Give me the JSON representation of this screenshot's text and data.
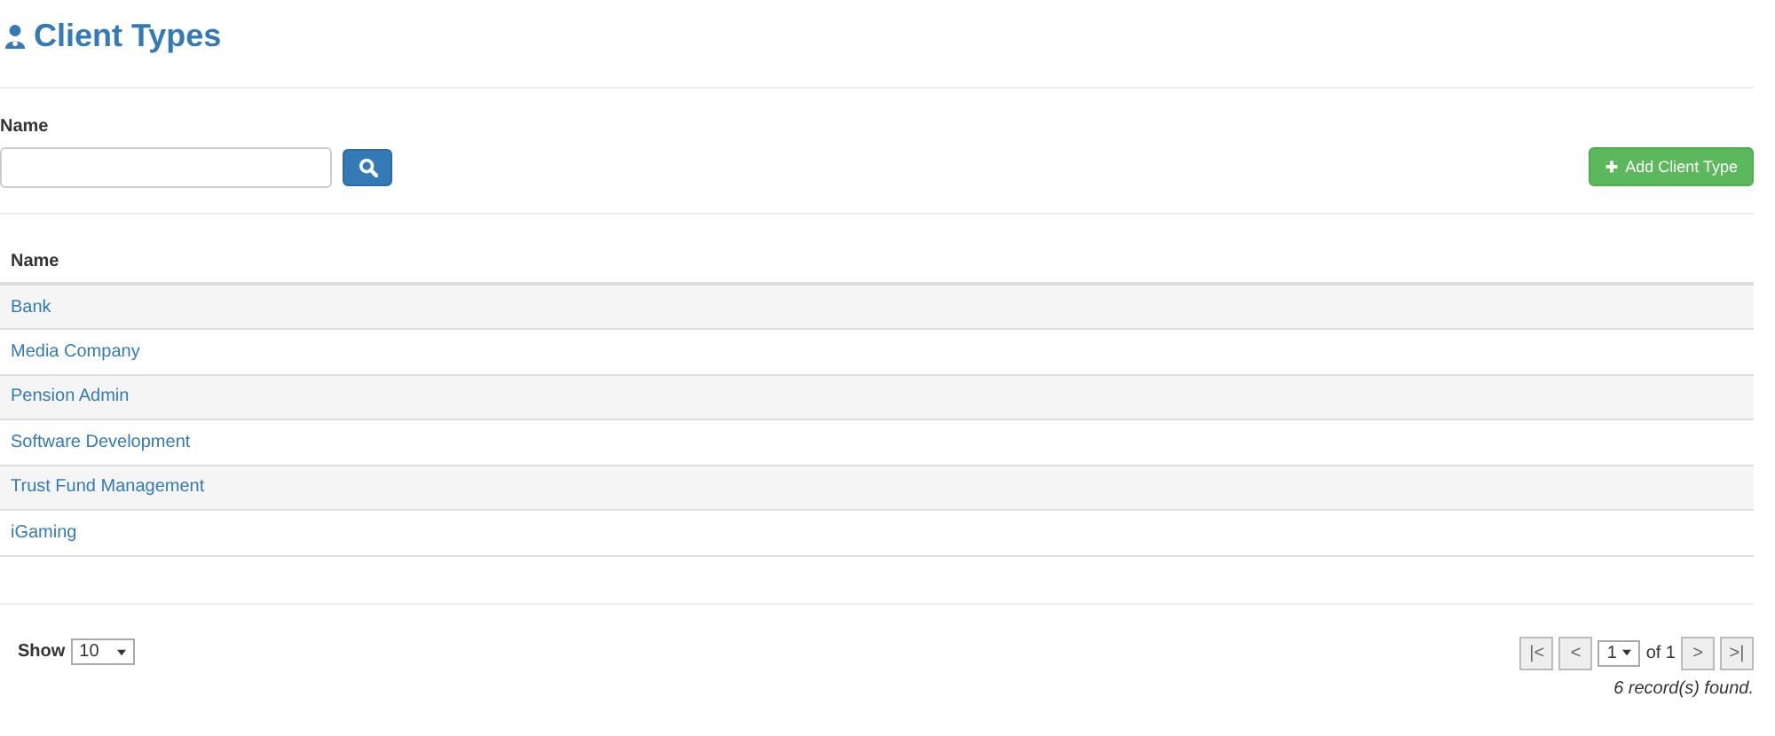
{
  "page": {
    "title": "Client Types"
  },
  "filter": {
    "label": "Name"
  },
  "add_button": {
    "label": "Add Client Type"
  },
  "table": {
    "columns": [
      "Name"
    ],
    "rows": [
      {
        "name": "Bank"
      },
      {
        "name": "Media Company"
      },
      {
        "name": "Pension Admin"
      },
      {
        "name": "Software Development"
      },
      {
        "name": "Trust Fund Management"
      },
      {
        "name": "iGaming"
      }
    ]
  },
  "footer": {
    "show_label": "Show",
    "page_size": "10",
    "pager": {
      "first": "|<",
      "prev": "<",
      "page": "1",
      "of": "of 1",
      "next": ">",
      "last": ">|"
    },
    "records": "6 record(s) found."
  }
}
